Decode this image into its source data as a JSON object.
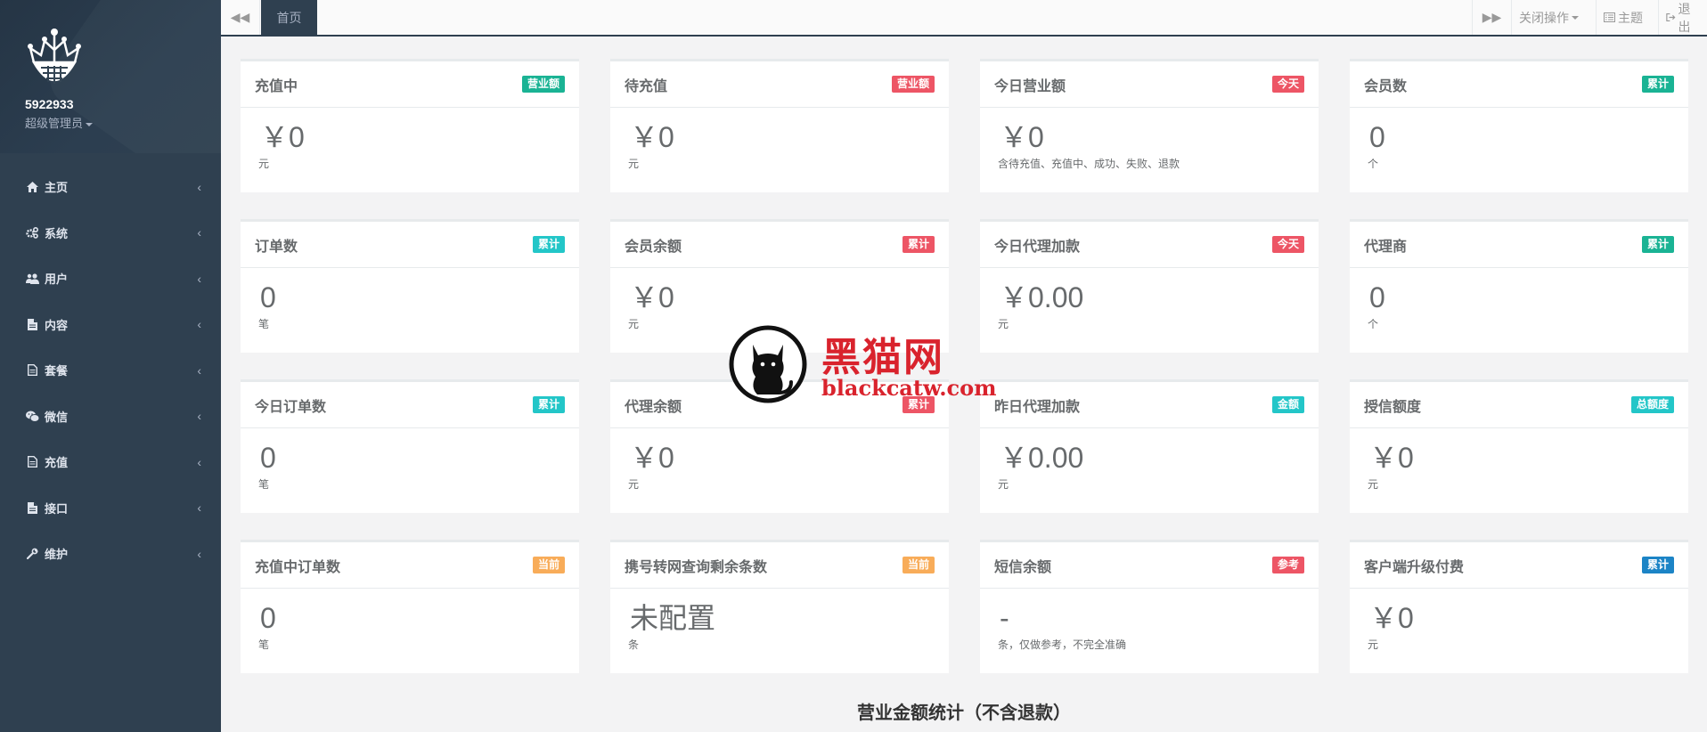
{
  "sidebar": {
    "username": "5922933",
    "role": "超级管理员",
    "items": [
      {
        "label": "主页",
        "icon": "home-icon"
      },
      {
        "label": "系统",
        "icon": "cogs-icon"
      },
      {
        "label": "用户",
        "icon": "users-icon"
      },
      {
        "label": "内容",
        "icon": "file-icon"
      },
      {
        "label": "套餐",
        "icon": "file-text-icon"
      },
      {
        "label": "微信",
        "icon": "wechat-icon"
      },
      {
        "label": "充值",
        "icon": "file-text-icon"
      },
      {
        "label": "接口",
        "icon": "file-icon"
      },
      {
        "label": "维护",
        "icon": "wrench-icon"
      }
    ]
  },
  "topbar": {
    "active_tab": "首页",
    "close_ops": "关闭操作",
    "theme": "主题",
    "logout": "退出"
  },
  "colors": {
    "green": "#1ab394",
    "red": "#ed5565",
    "cyan": "#23c6c8",
    "orange": "#f8ac59",
    "blue": "#1c84c6"
  },
  "cards": [
    {
      "title": "充值中",
      "badge": "营业额",
      "badge_color": "#1ab394",
      "value": "￥0",
      "unit": "元"
    },
    {
      "title": "待充值",
      "badge": "营业额",
      "badge_color": "#ed5565",
      "value": "￥0",
      "unit": "元"
    },
    {
      "title": "今日营业额",
      "badge": "今天",
      "badge_color": "#ed5565",
      "value": "￥0",
      "unit": "含待充值、充值中、成功、失败、退款"
    },
    {
      "title": "会员数",
      "badge": "累计",
      "badge_color": "#1ab394",
      "value": "0",
      "unit": "个"
    },
    {
      "title": "订单数",
      "badge": "累计",
      "badge_color": "#23c6c8",
      "value": "0",
      "unit": "笔"
    },
    {
      "title": "会员余额",
      "badge": "累计",
      "badge_color": "#ed5565",
      "value": "￥0",
      "unit": "元"
    },
    {
      "title": "今日代理加款",
      "badge": "今天",
      "badge_color": "#ed5565",
      "value": "￥0.00",
      "unit": "元"
    },
    {
      "title": "代理商",
      "badge": "累计",
      "badge_color": "#1ab394",
      "value": "0",
      "unit": "个"
    },
    {
      "title": "今日订单数",
      "badge": "累计",
      "badge_color": "#23c6c8",
      "value": "0",
      "unit": "笔"
    },
    {
      "title": "代理余额",
      "badge": "累计",
      "badge_color": "#ed5565",
      "value": "￥0",
      "unit": "元"
    },
    {
      "title": "昨日代理加款",
      "badge": "金额",
      "badge_color": "#23c6c8",
      "value": "￥0.00",
      "unit": "元"
    },
    {
      "title": "授信额度",
      "badge": "总额度",
      "badge_color": "#23c6c8",
      "value": "￥0",
      "unit": "元"
    },
    {
      "title": "充值中订单数",
      "badge": "当前",
      "badge_color": "#f8ac59",
      "value": "0",
      "unit": "笔"
    },
    {
      "title": "携号转网查询剩余条数",
      "badge": "当前",
      "badge_color": "#f8ac59",
      "value": "未配置",
      "unit": "条"
    },
    {
      "title": "短信余额",
      "badge": "参考",
      "badge_color": "#ed5565",
      "value": "-",
      "unit": "条，仅做参考，不完全准确"
    },
    {
      "title": "客户端升级付费",
      "badge": "累计",
      "badge_color": "#1c84c6",
      "value": "￥0",
      "unit": "元"
    }
  ],
  "section_title": "营业金额统计（不含退款）",
  "watermark": {
    "line1": "黑猫网",
    "line2": "blackcatw.com"
  }
}
